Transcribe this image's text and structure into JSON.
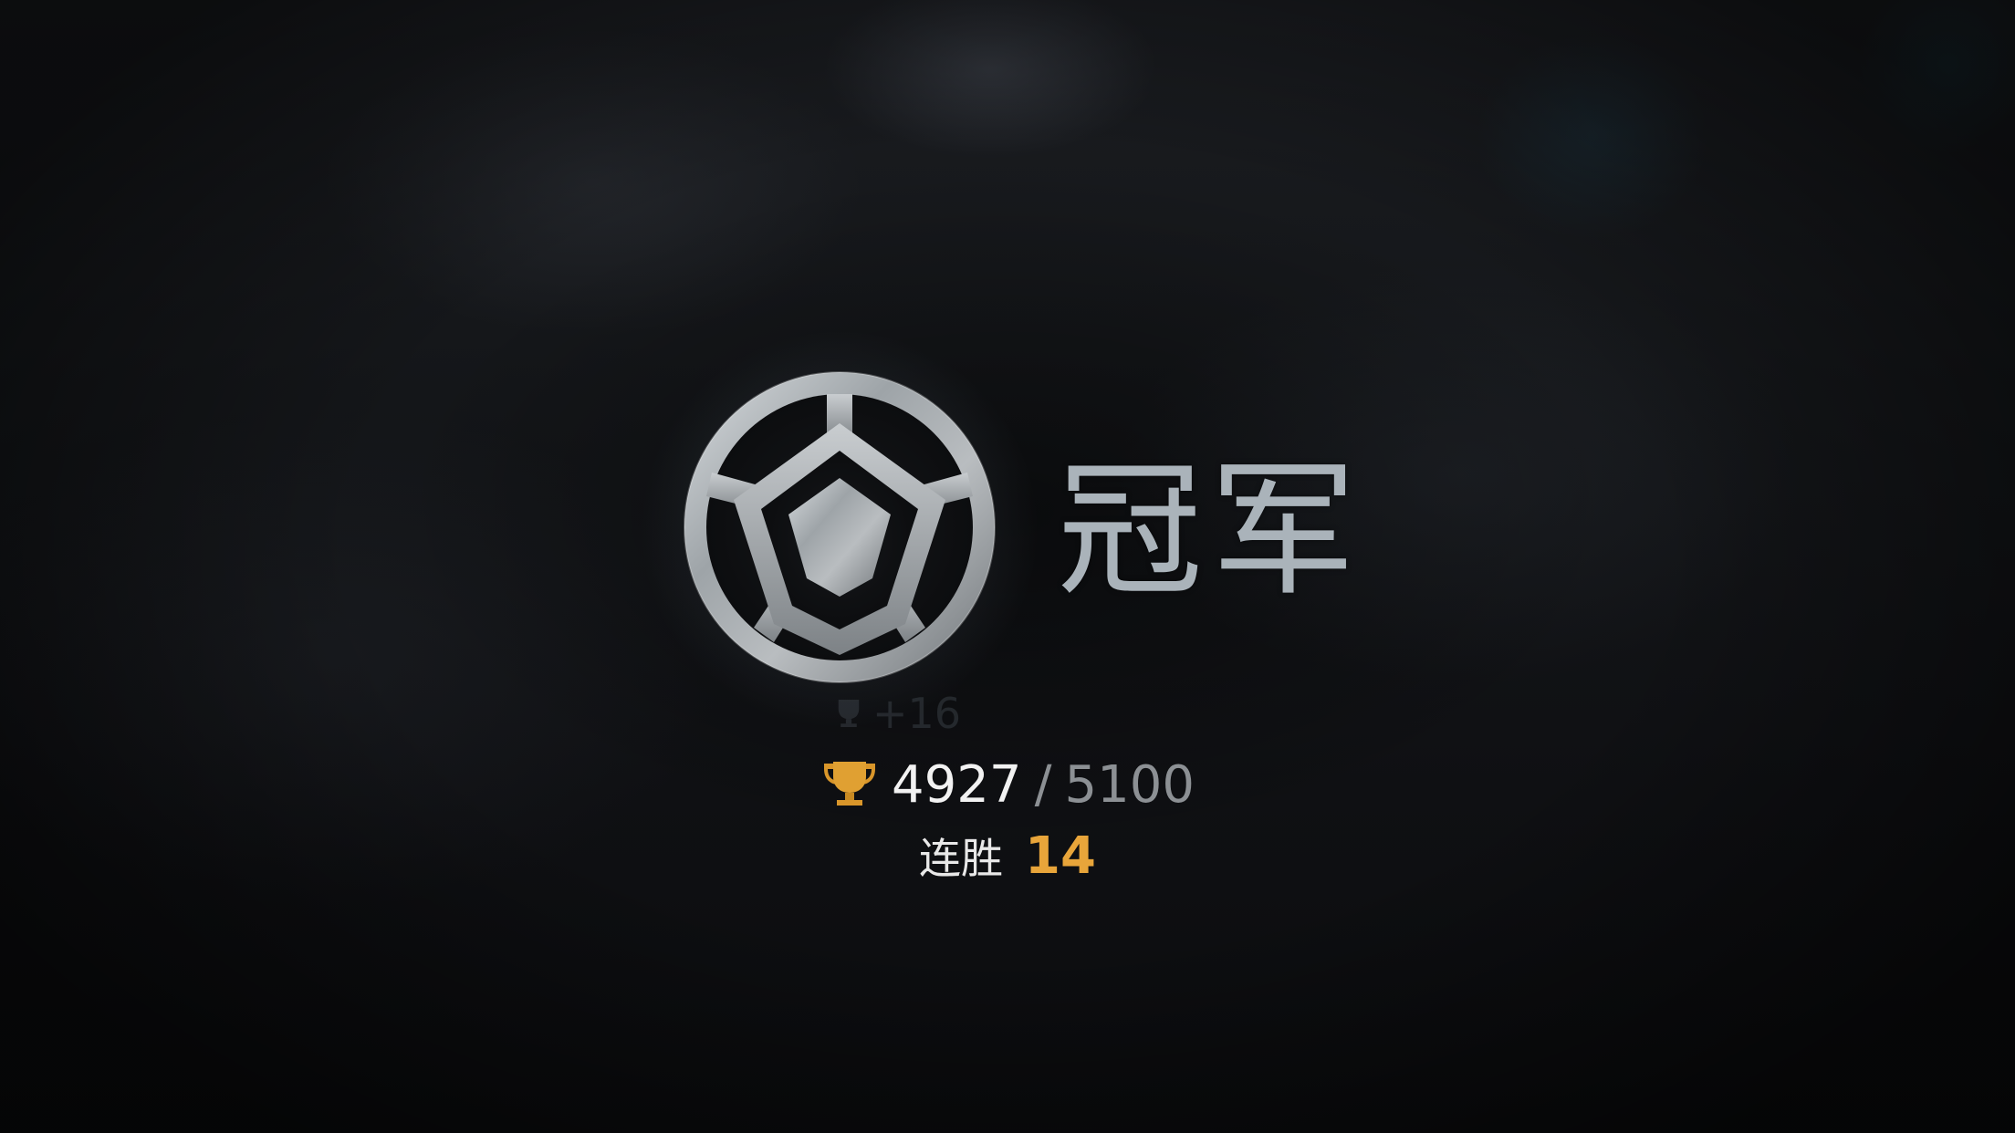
{
  "rank": {
    "name": "冠军",
    "emblem_icon": "champion-rank-emblem"
  },
  "trophy_gain": {
    "text": "+16"
  },
  "trophies": {
    "current": "4927",
    "separator": "/",
    "target": "5100",
    "icon": "trophy-icon",
    "icon_color": "#d9962a"
  },
  "win_streak": {
    "label": "连胜",
    "value": "14",
    "value_color": "#e8a53a"
  }
}
